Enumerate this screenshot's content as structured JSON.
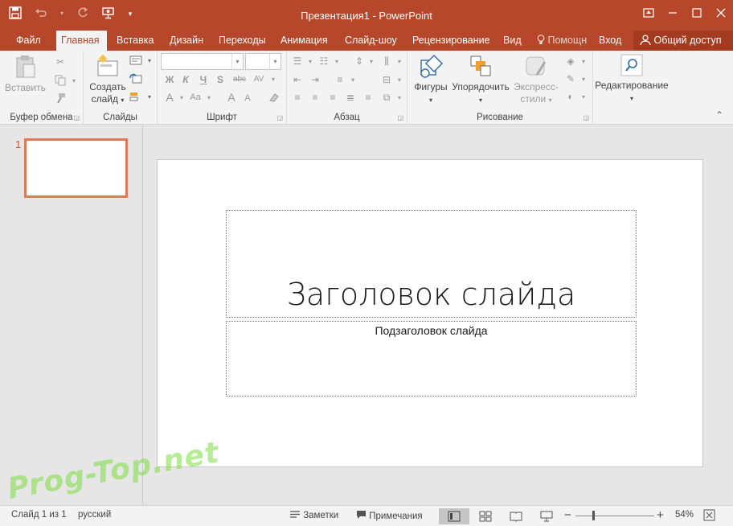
{
  "window": {
    "title": "Презентация1 - PowerPoint"
  },
  "qat": {
    "save_icon": "save-icon",
    "undo_icon": "undo-icon",
    "redo_icon": "redo-icon",
    "presenter_icon": "present-from-start-icon",
    "more_icon": "customize-qat-icon"
  },
  "tabs": [
    {
      "label": "Файл"
    },
    {
      "label": "Главная"
    },
    {
      "label": "Вставка"
    },
    {
      "label": "Дизайн"
    },
    {
      "label": "Переходы"
    },
    {
      "label": "Анимация"
    },
    {
      "label": "Слайд-шоу"
    },
    {
      "label": "Рецензирование"
    },
    {
      "label": "Вид"
    },
    {
      "label": "Помощн"
    },
    {
      "label": "Вход"
    }
  ],
  "share_label": "Общий доступ",
  "ribbon": {
    "clipboard": {
      "label": "Буфер обмена",
      "paste": "Вставить"
    },
    "slides": {
      "label": "Слайды",
      "new_slide_line1": "Создать",
      "new_slide_line2": "слайд"
    },
    "font": {
      "label": "Шрифт",
      "font_name": "",
      "font_size": "",
      "bold": "Ж",
      "italic": "К",
      "underline": "Ч",
      "strike": "abc",
      "spacing": "AV",
      "color_a": "A",
      "grow": "A",
      "shrink": "A"
    },
    "paragraph": {
      "label": "Абзац"
    },
    "drawing": {
      "label": "Рисование",
      "shapes": "Фигуры",
      "arrange": "Упорядочить",
      "quick_line1": "Экспресс-",
      "quick_line2": "стили"
    },
    "editing": {
      "label": "Редактирование"
    }
  },
  "thumbnails": [
    {
      "number": "1"
    }
  ],
  "slide": {
    "title": "Заголовок слайда",
    "subtitle": "Подзаголовок слайда"
  },
  "watermark": "Prog-Top.net",
  "status": {
    "slide_info": "Слайд 1 из 1",
    "language": "русский",
    "notes": "Заметки",
    "comments": "Примечания",
    "zoom": "54%"
  }
}
